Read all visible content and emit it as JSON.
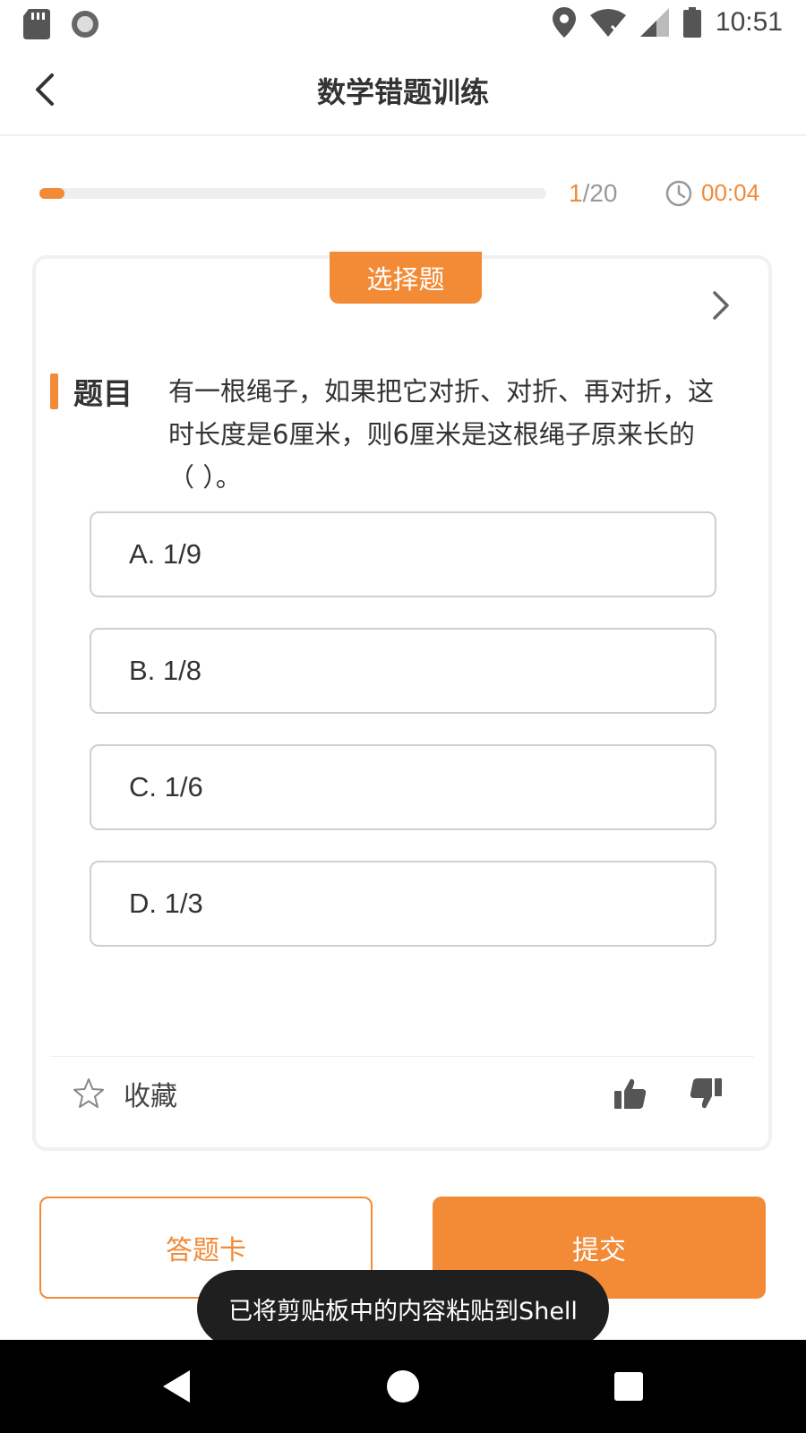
{
  "status_bar": {
    "time": "10:51"
  },
  "header": {
    "title": "数学错题训练"
  },
  "progress": {
    "current": "1",
    "total": "/20",
    "fraction": 0.05,
    "timer": "00:04"
  },
  "question": {
    "type_badge": "选择题",
    "label": "题目",
    "text": "有一根绳子，如果把它对折、对折、再对折，这时长度是6厘米，则6厘米是这根绳子原来长的（ ）。",
    "options": [
      "A. 1/9",
      "B. 1/8",
      "C. 1/6",
      "D. 1/3"
    ]
  },
  "card_footer": {
    "favorite_label": "收藏"
  },
  "buttons": {
    "answer_card": "答题卡",
    "submit": "提交"
  },
  "toast": {
    "message": "已将剪贴板中的内容粘贴到Shell"
  },
  "colors": {
    "accent": "#f28a36"
  }
}
